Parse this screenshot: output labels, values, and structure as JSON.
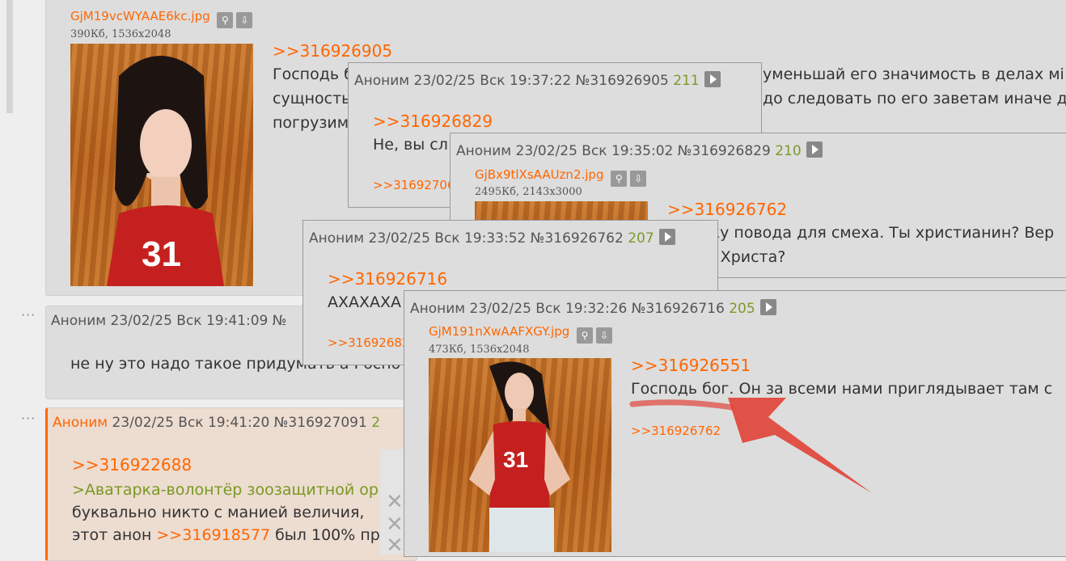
{
  "post_top": {
    "file_name": "GjM19vcWYAAE6kc.jpg",
    "file_meta": "390Кб, 1536x2048",
    "reply_ref": ">>316926905",
    "lines": [
      "Господь б",
      "сущность",
      "погрузим"
    ],
    "right_line1": "уменьшай его значимость в делах мі",
    "right_line2": "до следовать по его заветам иначе д"
  },
  "popup1": {
    "author": "Аноним",
    "datetime": "23/02/25 Вск 19:37:22",
    "number": "№316926905",
    "count": "211",
    "reply_ref": ">>316926829",
    "text": "Не, вы сл",
    "small_ref": ">>31692706"
  },
  "popup2": {
    "author": "Аноним",
    "datetime": "23/02/25 Вск 19:35:02",
    "number": "№316926829",
    "count": "210",
    "file_name": "GjBx9tlXsAAUzn2.jpg",
    "file_meta": "2495Кб, 2143x3000",
    "reply_ref": ">>316926762",
    "text1": "жу повода для смеха. Ты христианин? Вер",
    "text2": "а Христа?"
  },
  "popup3": {
    "author": "Аноним",
    "datetime": "23/02/25 Вск 19:33:52",
    "number": "№316926762",
    "count": "207",
    "reply_ref": ">>316926716",
    "text": "АХАХАХА",
    "small_ref": ">>31692682"
  },
  "popup4": {
    "author": "Аноним",
    "datetime": "23/02/25 Вск 19:32:26",
    "number": "№316926716",
    "count": "205",
    "file_name": "GjM191nXwAAFXGY.jpg",
    "file_meta": "473Кб, 1536x2048",
    "reply_ref": ">>316926551",
    "text": "Господь бог. Он за всеми нами приглядывает там с",
    "small_ref": ">>316926762"
  },
  "post_mid": {
    "author": "Аноним",
    "datetime": "23/02/25 Вск 19:41:09",
    "number_partial": "№",
    "text": "не ну это надо такое придумать а Госпо"
  },
  "post_bottom": {
    "author": "Аноним",
    "datetime": "23/02/25 Вск 19:41:20",
    "number": "№316927091",
    "count_partial": "2",
    "reply_ref": ">>316922688",
    "greentext": ">Аватарка-волонтёр зоозащитной ор",
    "line2": "буквально никто с манией величия,",
    "line3_prefix": "этот анон",
    "line3_ref": ">>316918577",
    "line3_suffix": "был 100% пра"
  },
  "colors": {
    "accent": "#ff6600",
    "green": "#789922",
    "post_bg": "#dddddd",
    "page_bg": "#eeeeee",
    "arrow": "#e0453a"
  },
  "icons": [
    "search-icon",
    "download-icon",
    "play-icon",
    "close-icon",
    "more-dots-icon"
  ]
}
